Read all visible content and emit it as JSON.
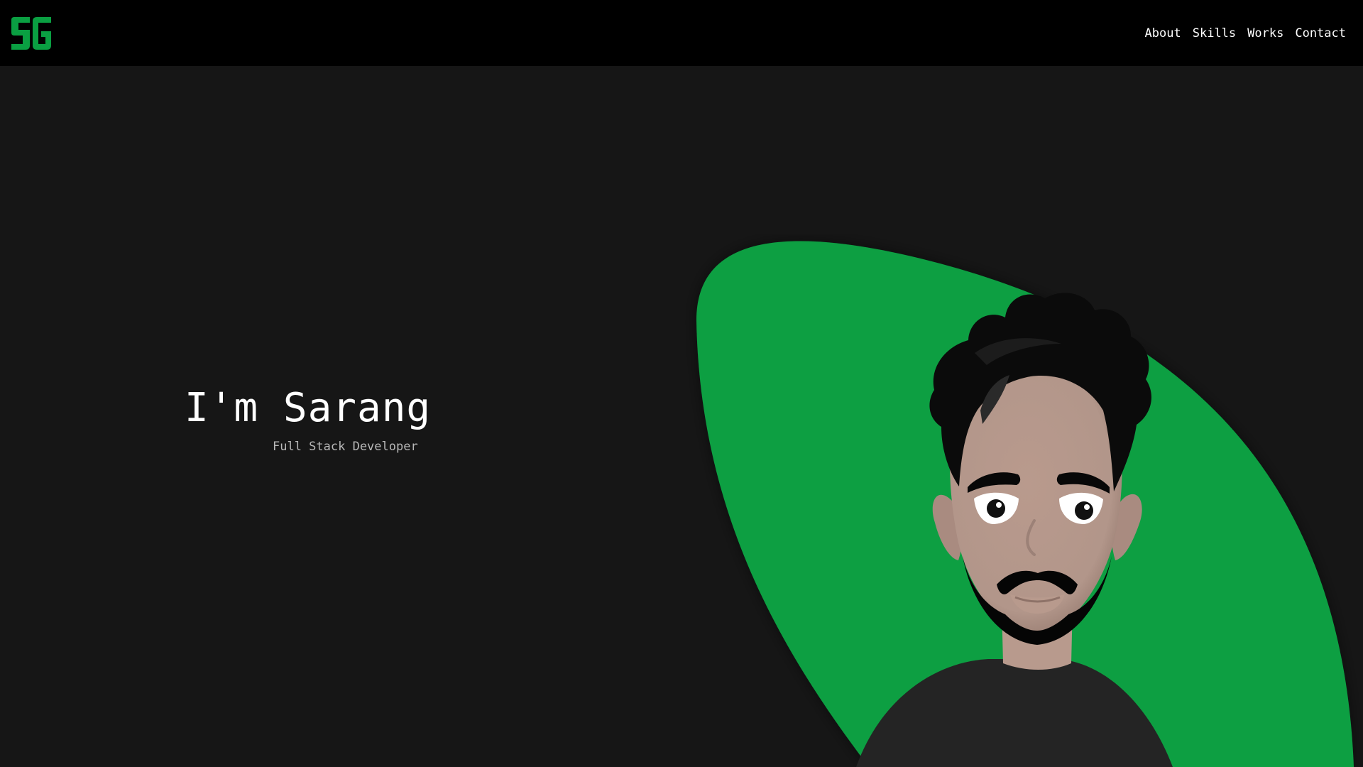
{
  "header": {
    "logo_text": "SG",
    "logo_color": "#0a9f42"
  },
  "nav": {
    "items": [
      {
        "label": "About"
      },
      {
        "label": "Skills"
      },
      {
        "label": "Works"
      },
      {
        "label": "Contact"
      }
    ]
  },
  "hero": {
    "title": "I'm Sarang",
    "subtitle": "Full Stack Developer",
    "accent_color": "#0a9f42",
    "background_color": "#161616"
  }
}
